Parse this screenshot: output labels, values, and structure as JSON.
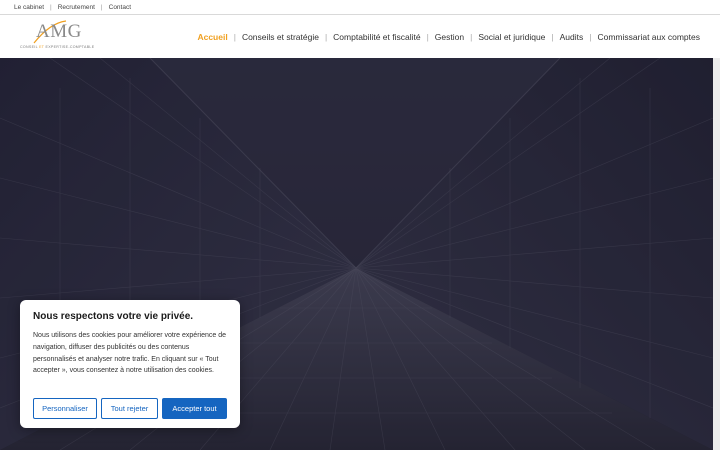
{
  "topbar": {
    "links": [
      "Le cabinet",
      "Recrutement",
      "Contact"
    ]
  },
  "logo": {
    "mark": "AMG",
    "tagline_prefix": "CONSEIL",
    "tagline_highlight": "ET",
    "tagline_suffix": "EXPERTISE-COMPTABLE"
  },
  "nav": {
    "items": [
      "Accueil",
      "Conseils et stratégie",
      "Comptabilité et fiscalité",
      "Gestion",
      "Social et juridique",
      "Audits",
      "Commissariat aux comptes"
    ],
    "active": "Accueil"
  },
  "cookie": {
    "title": "Nous respectons votre vie privée.",
    "body": "Nous utilisons des cookies pour améliorer votre expérience de navigation, diffuser des publicités ou des contenus personnalisés et analyser notre trafic. En cliquant sur « Tout accepter », vous consentez à notre utilisation des cookies.",
    "customize_label": "Personnaliser",
    "reject_label": "Tout rejeter",
    "accept_label": "Accepter tout"
  },
  "colors": {
    "accent": "#f0a020",
    "button": "#1565c0",
    "hero": "#27263a"
  }
}
